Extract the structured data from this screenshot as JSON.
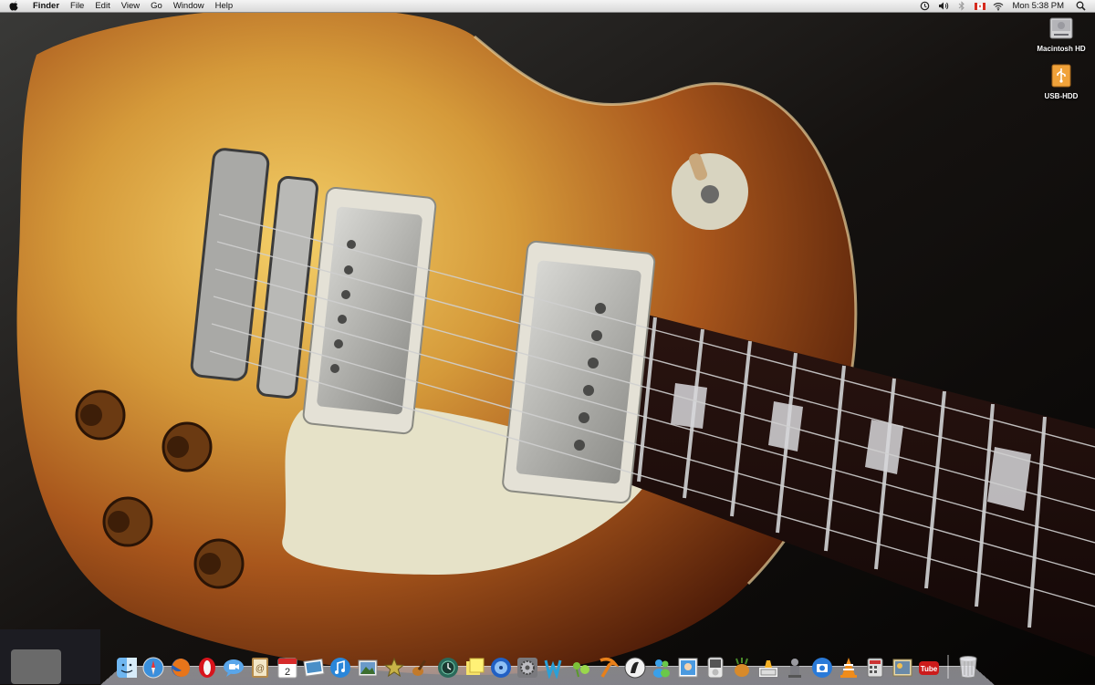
{
  "menubar": {
    "apple_icon": "apple-logo-icon",
    "app_name": "Finder",
    "menus": [
      "File",
      "Edit",
      "View",
      "Go",
      "Window",
      "Help"
    ],
    "status_icons": [
      "time-machine-icon",
      "volume-icon",
      "bluetooth-icon",
      "canada-flag-input-icon",
      "wifi-icon"
    ],
    "clock": "Mon 5:38 PM",
    "spotlight_icon": "spotlight-search-icon"
  },
  "desktop": {
    "icons": [
      {
        "label": "Macintosh HD",
        "icon": "hard-drive-icon"
      },
      {
        "label": "USB-HDD",
        "icon": "usb-drive-icon"
      }
    ]
  },
  "dock": {
    "apps": [
      "finder-icon",
      "safari-icon",
      "firefox-icon",
      "opera-icon",
      "ichat-icon",
      "address-book-icon",
      "ical-icon",
      "iphoto-icon",
      "itunes-icon",
      "preview-icon",
      "imovie-icon",
      "garageband-icon",
      "time-machine-icon",
      "stickies-icon",
      "dvd-player-icon",
      "system-preferences-icon",
      "dreamweaver-icon",
      "fireworks-icon",
      "pages-icon",
      "camino-icon",
      "messenger-icon",
      "photo-booth-icon",
      "itunes-dock-icon",
      "adium-icon",
      "chess-icon",
      "automator-icon",
      "image-capture-icon",
      "vlc-icon",
      "calculator-icon",
      "photoshop-icon",
      "youtube-icon"
    ],
    "trash_icon": "trash-icon",
    "youtube_label": "Tube",
    "ical_day": "2"
  }
}
